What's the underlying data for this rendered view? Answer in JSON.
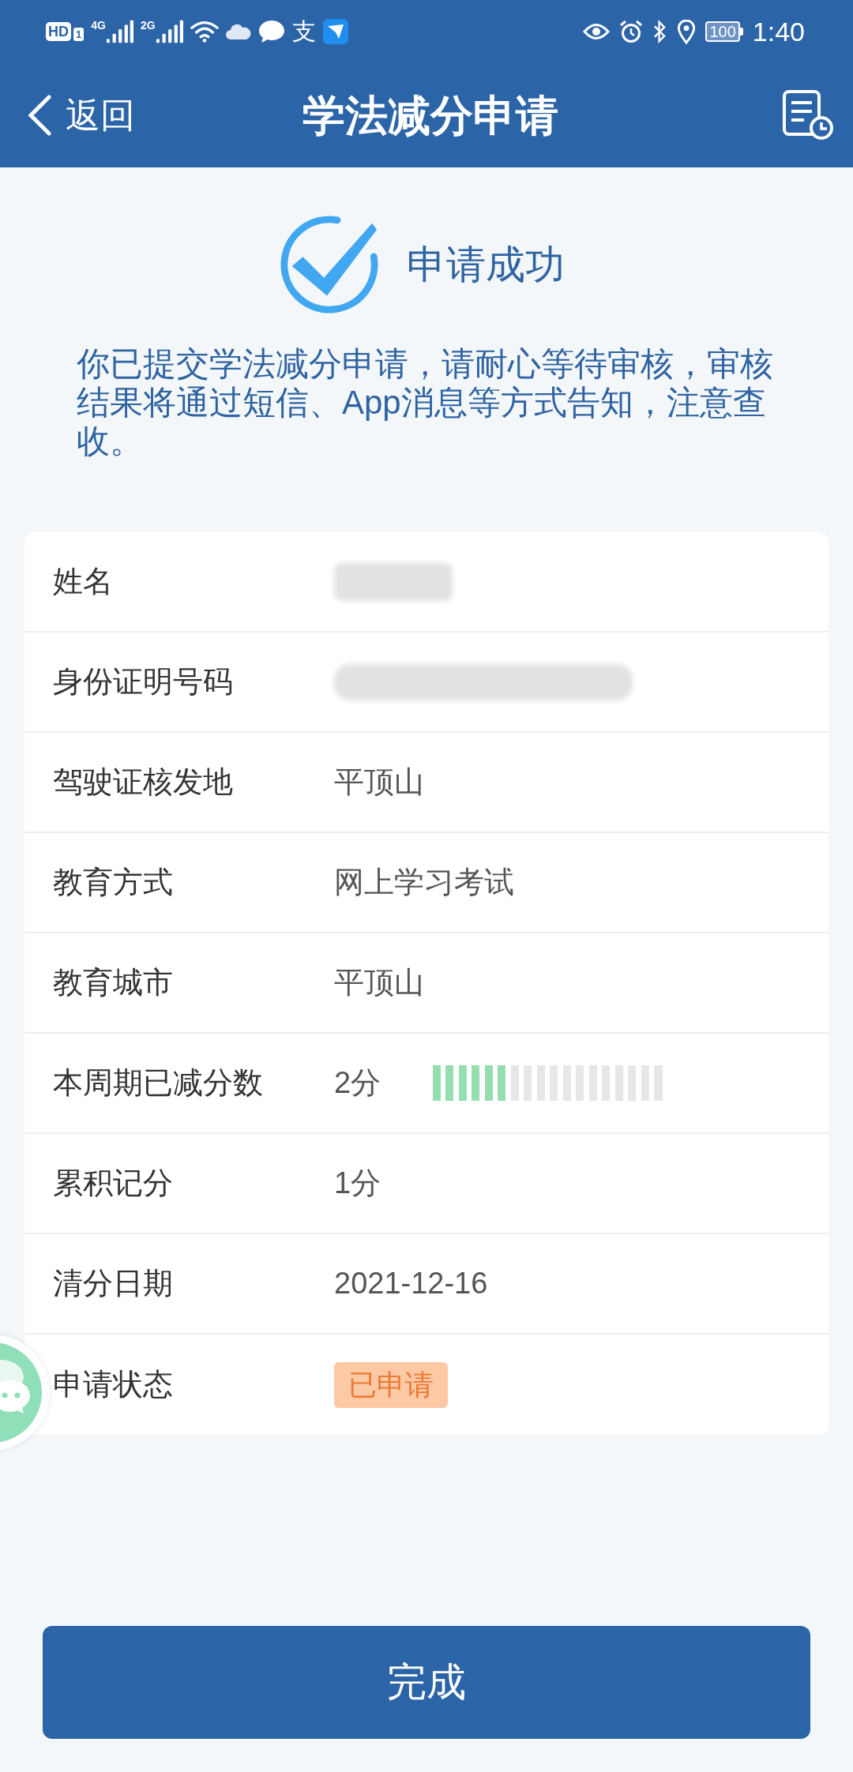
{
  "status_bar": {
    "hd": "HD",
    "sim": "1",
    "networks": [
      {
        "label": "4G"
      },
      {
        "label": "2G"
      }
    ],
    "app_glyph": "支",
    "battery": "100",
    "time": "1:40"
  },
  "header": {
    "back_label": "返回",
    "title": "学法减分申请"
  },
  "result": {
    "title": "申请成功",
    "message": "你已提交学法减分申请，请耐心等待审核，审核结果将通过短信、App消息等方式告知，注意查收。"
  },
  "details": [
    {
      "kind": "redacted",
      "label": "姓名"
    },
    {
      "kind": "redacted",
      "label": "身份证明号码"
    },
    {
      "kind": "text",
      "label": "驾驶证核发地",
      "value": "平顶山"
    },
    {
      "kind": "text",
      "label": "教育方式",
      "value": "网上学习考试"
    },
    {
      "kind": "text",
      "label": "教育城市",
      "value": "平顶山"
    },
    {
      "kind": "meter",
      "label": "本周期已减分数",
      "value": "2分",
      "level": 0.333
    },
    {
      "kind": "text",
      "label": "累积记分",
      "value": "1分"
    },
    {
      "kind": "text",
      "label": "清分日期",
      "value": "2021-12-16"
    },
    {
      "kind": "badge",
      "label": "申请状态",
      "value": "已申请"
    }
  ],
  "done_button": {
    "label": "完成"
  }
}
